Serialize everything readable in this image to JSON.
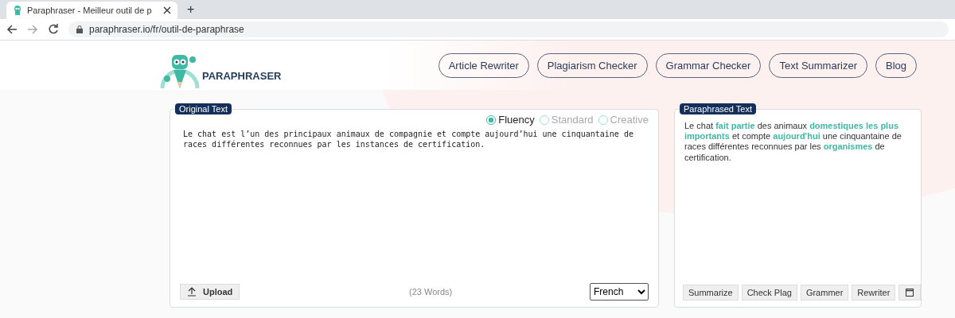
{
  "browser": {
    "tab_title": "Paraphraser - Meilleur outil de p",
    "new_tab": "+",
    "url": "paraphraser.io/fr/outil-de-paraphrase"
  },
  "header": {
    "logo_text": "PARAPHRASER",
    "nav": [
      {
        "label": "Article Rewriter"
      },
      {
        "label": "Plagiarism Checker"
      },
      {
        "label": "Grammar Checker"
      },
      {
        "label": "Text Summarizer"
      },
      {
        "label": "Blog"
      }
    ]
  },
  "original": {
    "title": "Original Text",
    "modes": [
      {
        "label": "Fluency",
        "selected": true
      },
      {
        "label": "Standard",
        "selected": false
      },
      {
        "label": "Creative",
        "selected": false
      }
    ],
    "text": "Le chat est l’un des principaux animaux de compagnie et compte aujourd’hui une cinquantaine de races différentes reconnues par les instances de certification.",
    "upload": "Upload",
    "word_count": "(23 Words)",
    "language": "French"
  },
  "paraphrased": {
    "title": "Paraphrased Text",
    "text": "Le chat **fait partie** des  animaux **domestiques les plus importants** et compte **aujourd'hui** une cinquantaine de races différentes reconnues par les **organismes** de certification.",
    "buttons": [
      {
        "label": "Summarize"
      },
      {
        "label": "Check Plag"
      },
      {
        "label": "Grammer"
      },
      {
        "label": "Rewriter"
      }
    ]
  }
}
